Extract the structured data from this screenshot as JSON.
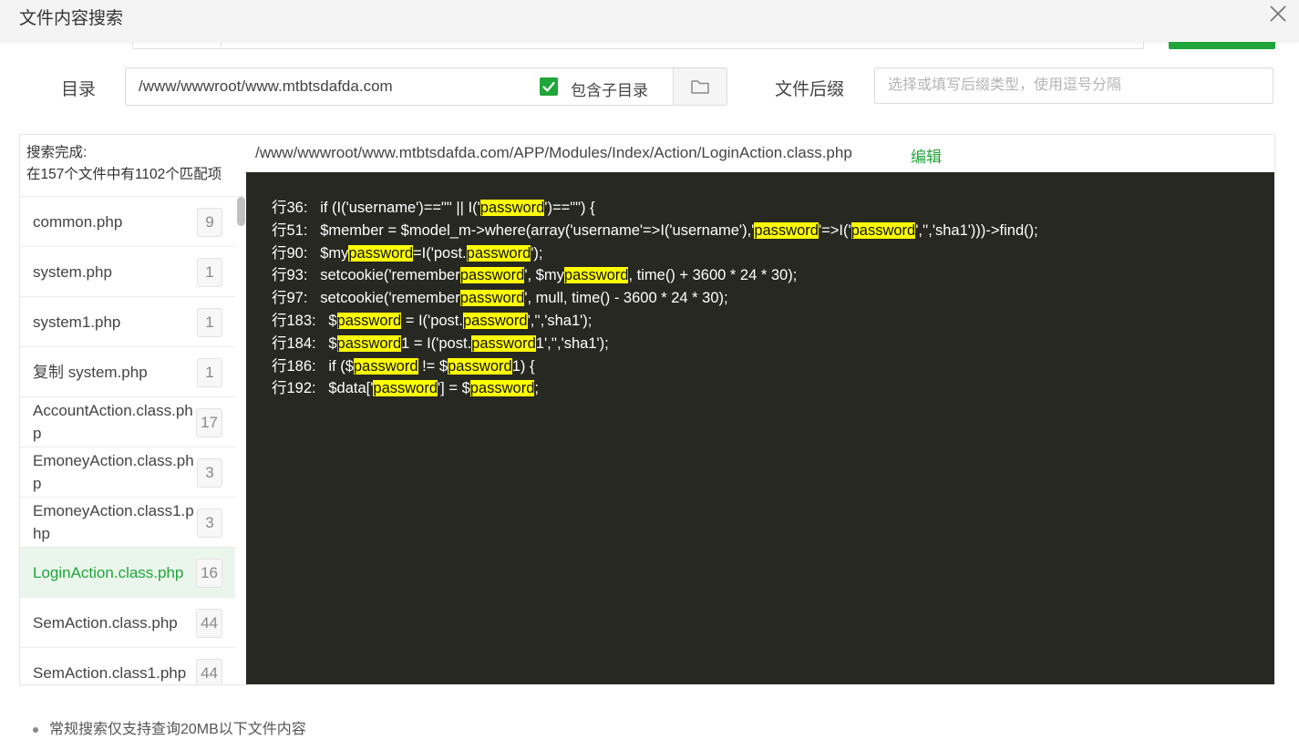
{
  "dialog": {
    "title": "文件内容搜索"
  },
  "search_form": {
    "dir_label": "目录",
    "dir_value": "/www/wwwroot/www.mtbtsdafda.com",
    "include_subdir_label": "包含子目录",
    "include_subdir_checked": true,
    "suffix_label": "文件后缀",
    "suffix_placeholder": "选择或填写后缀类型，使用逗号分隔",
    "suffix_value": ""
  },
  "results": {
    "status_line1": "搜索完成:",
    "status_line2": "在157个文件中有1102个匹配项",
    "files": [
      {
        "name": "common.php",
        "count": "9"
      },
      {
        "name": "system.php",
        "count": "1"
      },
      {
        "name": "system1.php",
        "count": "1"
      },
      {
        "name": "复制 system.php",
        "count": "1"
      },
      {
        "name": "AccountAction.class.php",
        "count": "17"
      },
      {
        "name": "EmoneyAction.class.php",
        "count": "3"
      },
      {
        "name": "EmoneyAction.class1.php",
        "count": "3"
      },
      {
        "name": "LoginAction.class.php",
        "count": "16",
        "active": true
      },
      {
        "name": "SemAction.class.php",
        "count": "44"
      },
      {
        "name": "SemAction.class1.php",
        "count": "44"
      }
    ]
  },
  "detail": {
    "path": "/www/wwwroot/www.mtbtsdafda.com/APP/Modules/Index/Action/LoginAction.class.php",
    "edit_label": "编辑",
    "highlight_term": "password",
    "lines": [
      "行36:   if (I('username')==\"\" || I('password')==\"\") {",
      "行51:   $member = $model_m->where(array('username'=>I('username'),'password'=>I('password','','sha1')))->find();",
      "行90:   $mypassword=I('post.password');",
      "行93:   setcookie('rememberpassword', $mypassword, time() + 3600 * 24 * 30);",
      "行97:   setcookie('rememberpassword', mull, time() - 3600 * 24 * 30);",
      "行183:   $password = I('post.password','','sha1');",
      "行184:   $password1 = I('post.password1','','sha1');",
      "行186:   if ($password != $password1) {",
      "行192:   $data['password'] = $password;"
    ]
  },
  "footer": {
    "note": "常规搜索仅支持查询20MB以下文件内容"
  },
  "colors": {
    "accent": "#20a53a",
    "code_bg": "#272822",
    "highlight": "#ffff00"
  }
}
